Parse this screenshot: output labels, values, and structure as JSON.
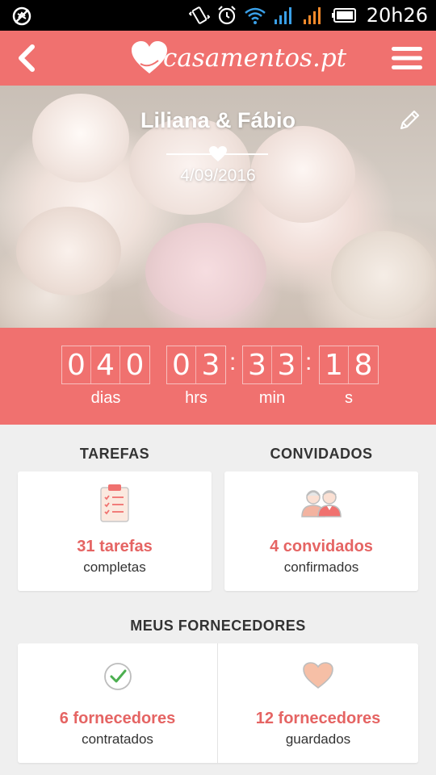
{
  "status_bar": {
    "time": "20h26",
    "icons": [
      "no-location-icon",
      "vibrate-icon",
      "alarm-icon",
      "wifi-icon",
      "signal-1-icon",
      "signal-2-icon",
      "battery-icon"
    ]
  },
  "app_bar": {
    "logo_text": "casamentos.pt",
    "back_icon": "chevron-left-icon",
    "menu_icon": "hamburger-menu-icon",
    "color": "#f0716f"
  },
  "hero": {
    "couple_names": "Liliana & Fábio",
    "wedding_date": "4/09/2016",
    "edit_icon": "pencil-icon"
  },
  "countdown": {
    "days": [
      "0",
      "4",
      "0"
    ],
    "hours": [
      "0",
      "3"
    ],
    "minutes": [
      "3",
      "3"
    ],
    "seconds": [
      "1",
      "8"
    ],
    "separator": ":",
    "labels": {
      "days": "dias",
      "hours": "hrs",
      "minutes": "min",
      "seconds": "s"
    }
  },
  "tasks": {
    "title": "TAREFAS",
    "value": "31 tarefas",
    "caption": "completas",
    "icon": "clipboard-checklist-icon"
  },
  "guests": {
    "title": "CONVIDADOS",
    "value": "4 convidados",
    "caption": "confirmados",
    "icon": "guests-couple-icon"
  },
  "vendors": {
    "title": "MEUS FORNECEDORES",
    "hired": {
      "value": "6 fornecedores",
      "caption": "contratados",
      "icon": "check-circle-icon"
    },
    "saved": {
      "value": "12 fornecedores",
      "caption": "guardados",
      "icon": "heart-icon"
    }
  },
  "colors": {
    "accent": "#f0716f",
    "value_text": "#e56463",
    "background": "#efefef"
  }
}
